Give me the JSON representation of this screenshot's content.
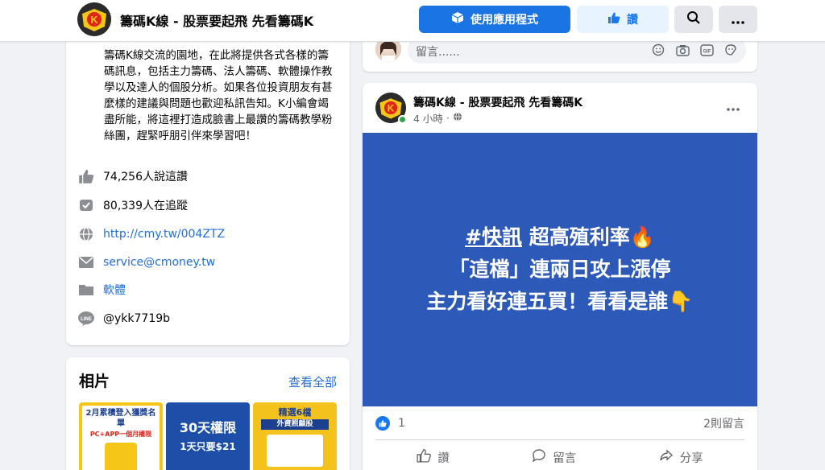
{
  "header": {
    "page_title": "籌碼K線 - 股票要起飛 先看籌碼K",
    "use_app_label": "使用應用程式",
    "like_label": "讚"
  },
  "about": {
    "text": "籌碼K線交流的園地，在此將提供各式各樣的籌碼訊息，包括主力籌碼、法人籌碼、軟體操作教學以及達人的個股分析。如果各位投資朋友有甚麼樣的建議與問題也歡迎私訊告知。K小編會竭盡所能，將這裡打造成臉書上最讚的籌碼教學粉絲團，趕緊呼朋引伴來學習吧！",
    "likes": "74,256人說這讚",
    "followers": "80,339人在追蹤",
    "website": "http://cmy.tw/004ZTZ",
    "email": "service@cmoney.tw",
    "category": "軟體",
    "line": "@ykk7719b"
  },
  "photos": {
    "title": "相片",
    "see_all": "查看全部",
    "thumb1": "2月累積登入獲獎名單",
    "thumb1_sub": "PC+APP一個月權限",
    "thumb2": "30天權限",
    "thumb2_sub": "1天只要$21",
    "thumb3": "精選6檔",
    "thumb3_sub": "外資照顧股"
  },
  "comment": {
    "placeholder": "留言......"
  },
  "post": {
    "author": "籌碼K線 - 股票要起飛 先看籌碼K",
    "time": "4 小時",
    "line1_hash": "#快訊",
    "line1_rest": " 超高殖利率🔥",
    "line2": "「這檔」連兩日攻上漲停",
    "line3": "主力看好連五買！看看是誰👇",
    "reactions": "1",
    "comments": "2則留言",
    "like_action": "讚",
    "comment_action": "留言",
    "share_action": "分享"
  },
  "colors": {
    "brand_blue": "#1b74e4",
    "post_bg": "#2d5ab8",
    "link": "#216fdb"
  }
}
